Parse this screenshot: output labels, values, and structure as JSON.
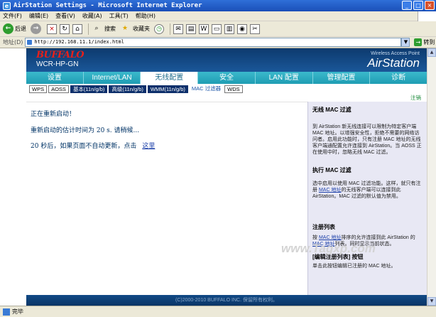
{
  "window": {
    "title": "AirStation Settings - Microsoft Internet Explorer",
    "menu": [
      "文件(F)",
      "编辑(E)",
      "查看(V)",
      "收藏(A)",
      "工具(T)",
      "帮助(H)"
    ],
    "toolbar": {
      "back_label": "后退",
      "search_label": "搜索",
      "favorites_label": "收藏夹"
    },
    "address": {
      "label": "地址(D)",
      "url": "http://192.168.11.1/index.html",
      "go_label": "转到"
    },
    "status": {
      "text": "完毕"
    }
  },
  "header": {
    "brand": "BUFFALO",
    "model": "WCR-HP-GN",
    "product_type": "Wireless Access Point",
    "product_name": "AirStation"
  },
  "nav": {
    "tabs": [
      {
        "label": "设置",
        "active": false
      },
      {
        "label": "Internet/LAN",
        "active": false
      },
      {
        "label": "无线配置",
        "active": true
      },
      {
        "label": "安全",
        "active": false
      },
      {
        "label": "LAN 配置",
        "active": false
      },
      {
        "label": "管理配置",
        "active": false
      },
      {
        "label": "诊断",
        "active": false
      }
    ],
    "subtabs": [
      {
        "label": "WPS",
        "style": "light"
      },
      {
        "label": "AOSS",
        "style": "light"
      },
      {
        "label": "基本(11n/g/b)",
        "style": "dark"
      },
      {
        "label": "高级(11n/g/b)",
        "style": "dark"
      },
      {
        "label": "WMM(11n/g/b)",
        "style": "dark"
      },
      {
        "label": "MAC 过滤器",
        "style": "current"
      },
      {
        "label": "WDS",
        "style": "light"
      }
    ],
    "logout": "注销"
  },
  "content": {
    "restarting": "正在重新启动！",
    "estimate": "重新启动的估计时间为  20 s. 请稍候...",
    "auto_refresh": "20 秒后，如果页面不自动更新，点击",
    "here_link": "这里"
  },
  "help": {
    "title1": "无线  MAC 过滤",
    "para1": "到 AirStation 新无线连接可以限制为特定客户端 MAC 地址。以增强安全性，拒绝不需要的网络访问者。启用此功能时，只有注册 MAC 地址的无线客户端通配置允许连接到 AirStation。当 AOSS 正在使用中时，忽略无线 MAC 过滤。",
    "title2": "执行 MAC 过滤",
    "para2_a": "选中启用以使用 MAC 过滤功能。这样，就只有注册",
    "para2_link": "MAC 地址",
    "para2_b": "的无线客户端可以连接到此 AirStation。MAC 过滤的默认值为禁用。",
    "title3": "注册列表",
    "para3_a": "按",
    "para3_link1": "MAC 地址",
    "para3_b": "排序的允许连接到此 AirStation 的",
    "para3_link2": "MAC 地址",
    "para3_c": "列表。同时显示当前状态。",
    "title4": "[编辑注册列表] 按钮",
    "para4": "单击此按钮编辑已注册的 MAC 地址。"
  },
  "footer": {
    "copyright": "(C)2000-2010 BUFFALO INC. 保留所有权利。"
  },
  "watermark": {
    "text": "www.Tagxp.com"
  },
  "colors": {
    "header_bg": "#0d3a6e",
    "nav_bg": "#1f9db3",
    "brand_red": "#e8201a",
    "help_bg": "#e8e8f4",
    "link": "#1a3ea8"
  }
}
